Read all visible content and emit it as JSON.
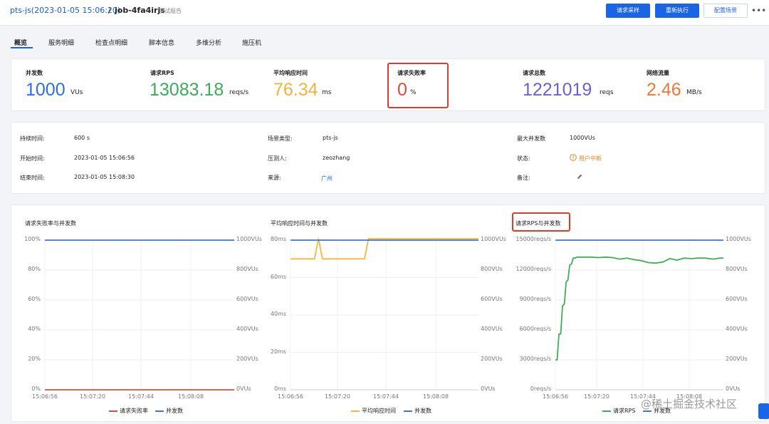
{
  "header": {
    "scene": "pts-js(2023-01-05 15:06:20)",
    "separator": "/",
    "job": "job-4fa4irjs",
    "tag": "测试报告",
    "buttons": {
      "sample": "请求采样",
      "rerun": "重新执行",
      "config": "配置场景"
    },
    "more_icon": "more-icon"
  },
  "tabs": [
    "概览",
    "服务明细",
    "检查点明细",
    "脚本信息",
    "多维分析",
    "施压机"
  ],
  "kpis": [
    {
      "label": "并发数",
      "value": "1000",
      "unit": "VUs",
      "color": "#2f6fdc"
    },
    {
      "label": "请求RPS",
      "value": "13083.18",
      "unit": "reqs/s",
      "color": "#3daa5c"
    },
    {
      "label": "平均响应时间",
      "value": "76.34",
      "unit": "ms",
      "color": "#f0b43a"
    },
    {
      "label": "请求失败率",
      "value": "0",
      "unit": "%",
      "color": "#e24a36"
    },
    {
      "label": "请求总数",
      "value": "1221019",
      "unit": "reqs",
      "color": "#6a62c6"
    },
    {
      "label": "网络流量",
      "value": "2.46",
      "unit": "MB/s",
      "color": "#e97a37"
    }
  ],
  "info": {
    "duration_label": "持续时间:",
    "duration": "600 s",
    "start_label": "开始时间:",
    "start": "2023-01-05 15:06:56",
    "end_label": "结束时间:",
    "end": "2023-01-05 15:08:30",
    "scene_type_label": "场景类型:",
    "scene_type": "pts-js",
    "tester_label": "压测人:",
    "tester": "zeozhang",
    "source_label": "来源:",
    "source": "广州",
    "max_label": "最大并发数",
    "max": "1000VUs",
    "status_label": "状态:",
    "status": "用户中断",
    "status_icon": "warning-circle-icon",
    "note_label": "备注:",
    "note_icon": "pencil-icon"
  },
  "watermark": "@稀土掘金技术社区",
  "colors": {
    "blue": "#3b74db",
    "red": "#e24a36",
    "yellow": "#f5b73b",
    "green": "#3fae55"
  },
  "chart_data": [
    {
      "type": "line",
      "title": "请求失败率与并发数",
      "x_ticks": [
        "15:06:56",
        "15:07:20",
        "15:07:44",
        "15:08:08"
      ],
      "y_left_ticks": [
        "0%",
        "20%",
        "40%",
        "60%",
        "80%",
        "100%"
      ],
      "y_right_ticks": [
        "0VUs",
        "200VUs",
        "400VUs",
        "600VUs",
        "800VUs",
        "1000VUs"
      ],
      "ylim_left": [
        0,
        100
      ],
      "ylim_right": [
        0,
        1000
      ],
      "xlim": [
        0,
        94
      ],
      "grid": true,
      "legend_position": "bottom",
      "series": [
        {
          "name": "请求失败率",
          "axis": "left",
          "color": "#e24a36",
          "x": [
            0,
            94
          ],
          "y": [
            0,
            0
          ]
        },
        {
          "name": "并发数",
          "axis": "right",
          "color": "#3b74db",
          "x": [
            0,
            94
          ],
          "y": [
            1000,
            1000
          ]
        }
      ]
    },
    {
      "type": "line",
      "title": "平均响应时间与并发数",
      "x_ticks": [
        "15:06:56",
        "15:07:20",
        "15:07:44",
        "15:08:08"
      ],
      "y_left_ticks": [
        "0ms",
        "20ms",
        "40ms",
        "60ms",
        "80ms"
      ],
      "y_right_ticks": [
        "0VUs",
        "200VUs",
        "400VUs",
        "600VUs",
        "800VUs",
        "1000VUs"
      ],
      "ylim_left": [
        0,
        80
      ],
      "ylim_right": [
        0,
        1000
      ],
      "xlim": [
        0,
        94
      ],
      "grid": true,
      "legend_position": "bottom",
      "series": [
        {
          "name": "平均响应时间",
          "axis": "left",
          "color": "#f5b73b",
          "x": [
            0,
            12,
            14,
            16,
            37,
            39,
            94
          ],
          "y": [
            70,
            70,
            85,
            70,
            70,
            82,
            82
          ]
        },
        {
          "name": "并发数",
          "axis": "right",
          "color": "#3b74db",
          "x": [
            0,
            94
          ],
          "y": [
            1000,
            1000
          ]
        }
      ]
    },
    {
      "type": "line",
      "title": "请求RPS与并发数",
      "x_ticks": [
        "15:06:56",
        "15:07:20",
        "15:07:44",
        "15:08:08"
      ],
      "y_left_ticks": [
        "0reqs/s",
        "3000reqs/s",
        "6000reqs/s",
        "9000reqs/s",
        "12000reqs/s",
        "15000reqs/s"
      ],
      "y_right_ticks": [
        "0VUs",
        "200VUs",
        "400VUs",
        "600VUs",
        "800VUs",
        "1000VUs"
      ],
      "ylim_left": [
        0,
        15000
      ],
      "ylim_right": [
        0,
        1000
      ],
      "xlim": [
        0,
        94
      ],
      "grid": true,
      "legend_position": "bottom",
      "series": [
        {
          "name": "请求RPS",
          "axis": "left",
          "color": "#3fae55",
          "x": [
            0,
            1,
            2,
            3,
            4,
            5,
            6,
            7,
            8,
            9,
            10,
            11,
            12,
            14,
            16,
            20,
            24,
            28,
            32,
            36,
            40,
            44,
            48,
            52,
            56,
            60,
            64,
            68,
            72,
            76,
            80,
            84,
            88,
            92,
            94
          ],
          "y": [
            3000,
            3000,
            5600,
            5600,
            8400,
            8600,
            10800,
            11000,
            12500,
            12600,
            13200,
            13200,
            13300,
            13300,
            13300,
            13300,
            13250,
            13300,
            13250,
            13100,
            13200,
            13050,
            12950,
            12750,
            12700,
            12800,
            13150,
            13000,
            13200,
            13150,
            13200,
            13200,
            13100,
            13200,
            13200
          ]
        },
        {
          "name": "并发数",
          "axis": "right",
          "color": "#3b74db",
          "x": [
            0,
            94
          ],
          "y": [
            1000,
            1000
          ]
        }
      ]
    }
  ]
}
